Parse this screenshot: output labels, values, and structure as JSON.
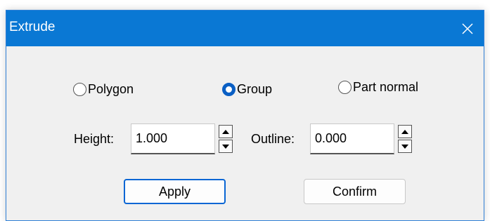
{
  "window": {
    "title": "Extrude"
  },
  "icons": {
    "close": "close-icon",
    "spin_up": "triangle-up-icon",
    "spin_down": "triangle-down-icon"
  },
  "colors": {
    "titlebar": "#0a78d4",
    "accent": "#0a5fc4",
    "dialog_bg": "#f0f0f0"
  },
  "mode": {
    "options": [
      {
        "label": "Polygon",
        "checked": false
      },
      {
        "label": "Group",
        "checked": true
      },
      {
        "label": "Part normal",
        "checked": false
      }
    ]
  },
  "fields": {
    "height_label": "Height:",
    "height_value": "1.000",
    "outline_label": "Outline:",
    "outline_value": "0.000"
  },
  "buttons": {
    "apply": "Apply",
    "confirm": "Confirm"
  }
}
